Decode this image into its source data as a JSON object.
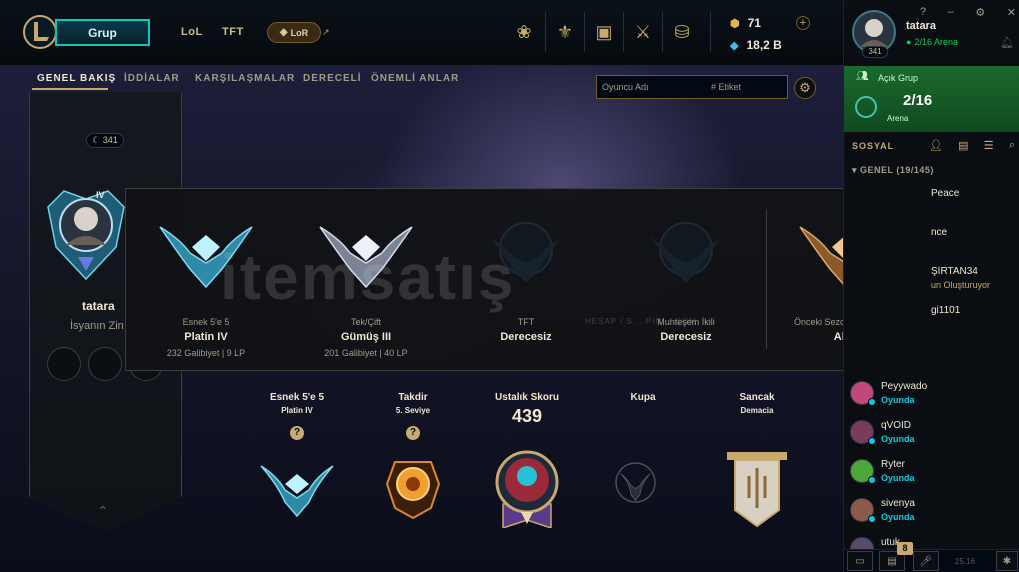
{
  "top": {
    "play_label": "Grup",
    "tabs": [
      "LoL",
      "TFT"
    ],
    "lor_label": "LoR",
    "lor_link_glyph": "↗",
    "nav_icons": [
      "tft-icon",
      "collection-icon",
      "loot-icon",
      "clash-icon",
      "store-icon"
    ],
    "rp": "71",
    "be": "18,2 B"
  },
  "subnav": {
    "tabs": [
      "GENEL BAKIŞ",
      "İDDİALAR",
      "KARŞILAŞMALAR",
      "DERECELİ",
      "ÖNEMLİ ANLAR"
    ],
    "search_placeholder": "Oyuncu Adı",
    "search_tag": "# Etiket"
  },
  "profile": {
    "level": "341",
    "rank_tier": "IV",
    "name": "tatara",
    "subtitle": "İsyanın Zin"
  },
  "ranked_popup": [
    {
      "queue": "Esnek 5'e 5",
      "rank": "Platin IV",
      "record": "232 Galibiyet | 9 LP",
      "tier_color": "#3aa3b8"
    },
    {
      "queue": "Tek/Çift",
      "rank": "Gümüş III",
      "record": "201 Galibiyet | 40 LP",
      "tier_color": "#9aa6b8"
    },
    {
      "queue": "TFT",
      "rank": "Derecesiz",
      "record": "",
      "tier_color": "#1c2630"
    },
    {
      "queue": "Muhteşem İkili",
      "rank": "Derecesiz",
      "record": "",
      "tier_color": "#1c2630"
    },
    {
      "queue": "Önceki Sezonun Derecesi",
      "rank": "Altın",
      "record": "",
      "tier_color": "#b07a3c"
    }
  ],
  "watermark": {
    "text": "itemsatış",
    "sub": "HESAP / S... PIN ...COM"
  },
  "crests": [
    {
      "title": "Esnek 5'e 5",
      "sub": "Platin IV",
      "help": "?"
    },
    {
      "title": "Takdir",
      "sub": "5. Seviye",
      "help": "?"
    },
    {
      "title": "Ustalık Skoru",
      "score": "439"
    },
    {
      "title": "Kupa"
    },
    {
      "title": "Sancak",
      "sub": "Demacia"
    }
  ],
  "social": {
    "window_controls": [
      "?",
      "–",
      "⚙",
      "✕"
    ],
    "me": {
      "name": "tatara",
      "level": "341",
      "status": "2/16 Arena"
    },
    "group": {
      "label": "Açık Grup",
      "count": "2/16",
      "mode": "Arena"
    },
    "title": "SOSYAL",
    "group_header": "GENEL (19/145)",
    "friends": [
      {
        "name": "Peace",
        "status": "",
        "avatar": "#3b4f6b"
      },
      {
        "name": "nce",
        "status": "",
        "avatar": "#4a3b2a"
      },
      {
        "name": "ŞIRTAN34",
        "status": "un Oluşturuyor",
        "avatar": "#2f3a4a",
        "gold": true
      },
      {
        "name": "gi1101",
        "status": "",
        "avatar": "#3a2f4a"
      },
      {
        "name": "Peyywado",
        "status": "Oyunda",
        "avatar": "#c0487a"
      },
      {
        "name": "qVOID",
        "status": "Oyunda",
        "avatar": "#7a3a5a"
      },
      {
        "name": "Ryter",
        "status": "Oyunda",
        "avatar": "#4aa83a"
      },
      {
        "name": "sivenya",
        "status": "Oyunda",
        "avatar": "#8a5a4a"
      },
      {
        "name": "utuk",
        "status": "",
        "avatar": "#5a4a6a"
      }
    ],
    "chat_badge": "8",
    "version": "25.16"
  }
}
